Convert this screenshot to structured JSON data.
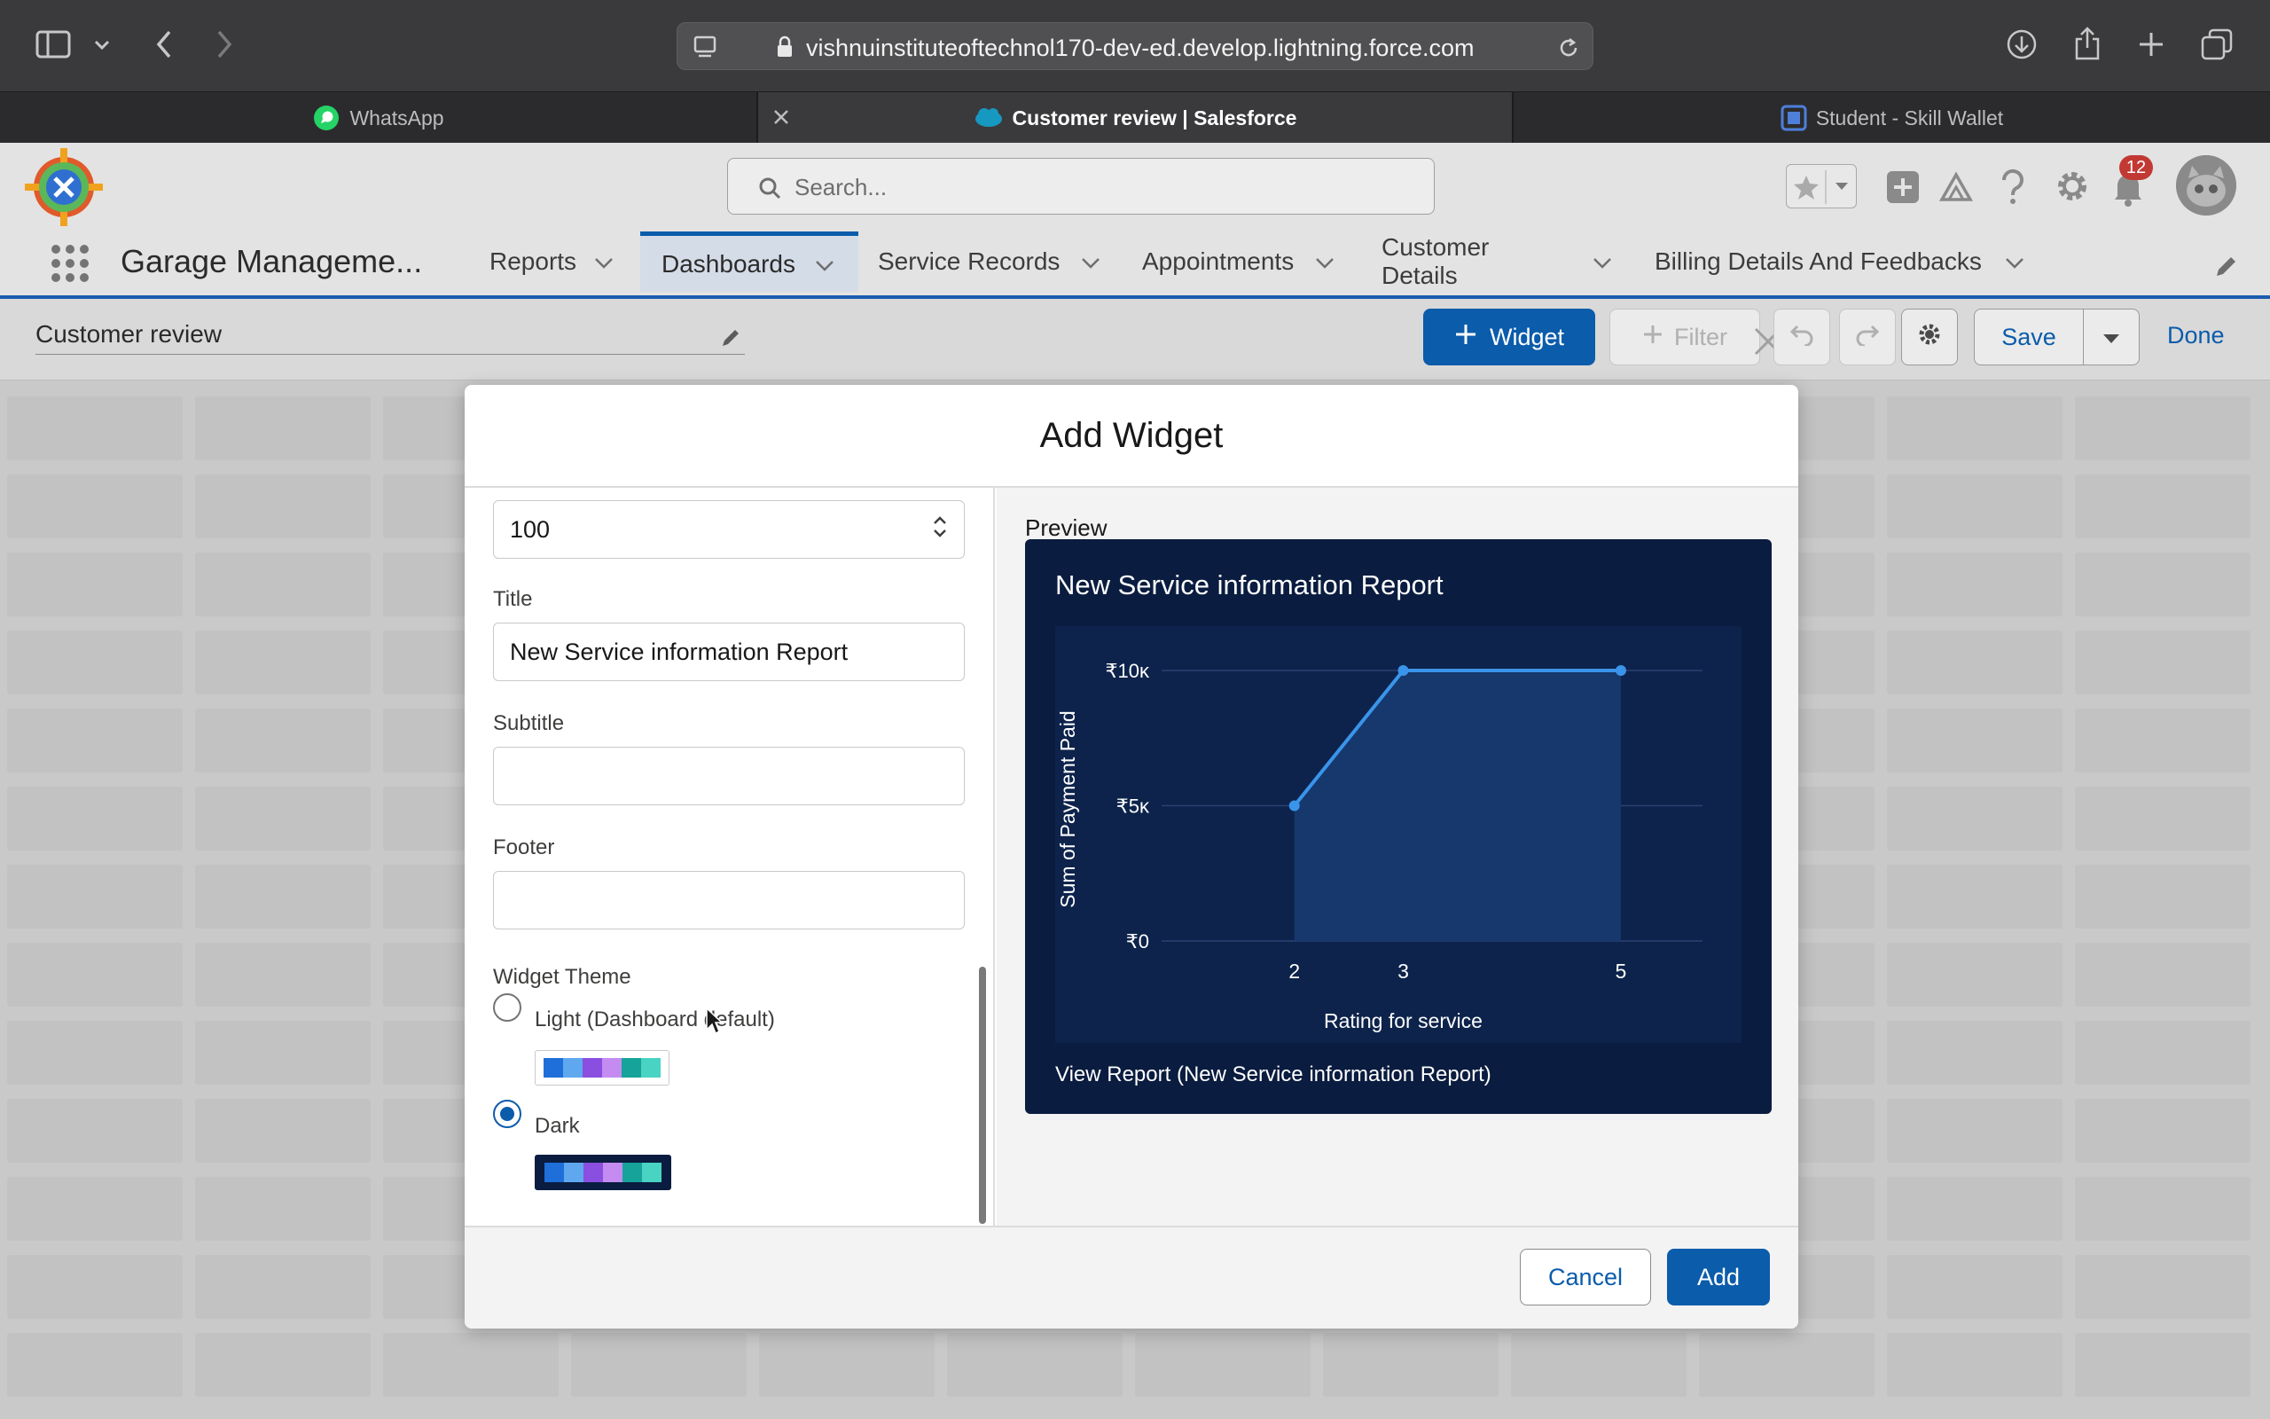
{
  "browser": {
    "url": "vishnuinstituteoftechnol170-dev-ed.develop.lightning.force.com",
    "tabs": [
      {
        "label": "WhatsApp",
        "active": false
      },
      {
        "label": "Customer review | Salesforce",
        "active": true
      },
      {
        "label": "Student - Skill Wallet",
        "active": false
      }
    ]
  },
  "header": {
    "search_placeholder": "Search...",
    "notification_count": "12",
    "app_name": "Garage Manageme...",
    "nav": [
      {
        "label": "Reports"
      },
      {
        "label": "Dashboards"
      },
      {
        "label": "Service Records"
      },
      {
        "label": "Appointments"
      },
      {
        "label": "Customer Details"
      },
      {
        "label": "Billing Details And Feedbacks"
      }
    ]
  },
  "toolbar": {
    "dashboard_name": "Customer review",
    "widget_label": "Widget",
    "filter_label": "Filter",
    "save_label": "Save",
    "done_label": "Done"
  },
  "modal": {
    "title": "Add Widget",
    "max_value": "100",
    "title_label": "Title",
    "title_value": "New Service information Report",
    "subtitle_label": "Subtitle",
    "subtitle_value": "",
    "footer_label": "Footer",
    "footer_value": "",
    "theme_label": "Widget Theme",
    "theme_light": "Light (Dashboard default)",
    "theme_dark": "Dark",
    "selected_theme": "Dark",
    "preview_label": "Preview",
    "cancel_label": "Cancel",
    "add_label": "Add"
  },
  "colors": {
    "brand": "#0b5cab",
    "chart_bg": "#0a1c3f",
    "series": "#3a94ea",
    "swatches": [
      "#1e6fd9",
      "#5fa7ee",
      "#8a4fe0",
      "#c48cf0",
      "#16a39a",
      "#48d3c3"
    ]
  },
  "chart_data": {
    "type": "area",
    "title": "New Service information Report",
    "xlabel": "Rating for service",
    "ylabel": "Sum of Payment Paid",
    "categories": [
      "2",
      "3",
      "5"
    ],
    "values": [
      5000,
      10000,
      10000
    ],
    "ylim": [
      0,
      10000
    ],
    "y_ticks": [
      "₹0",
      "₹5κ",
      "₹10κ"
    ],
    "grid": true,
    "footer_link": "View Report (New Service information Report)"
  }
}
